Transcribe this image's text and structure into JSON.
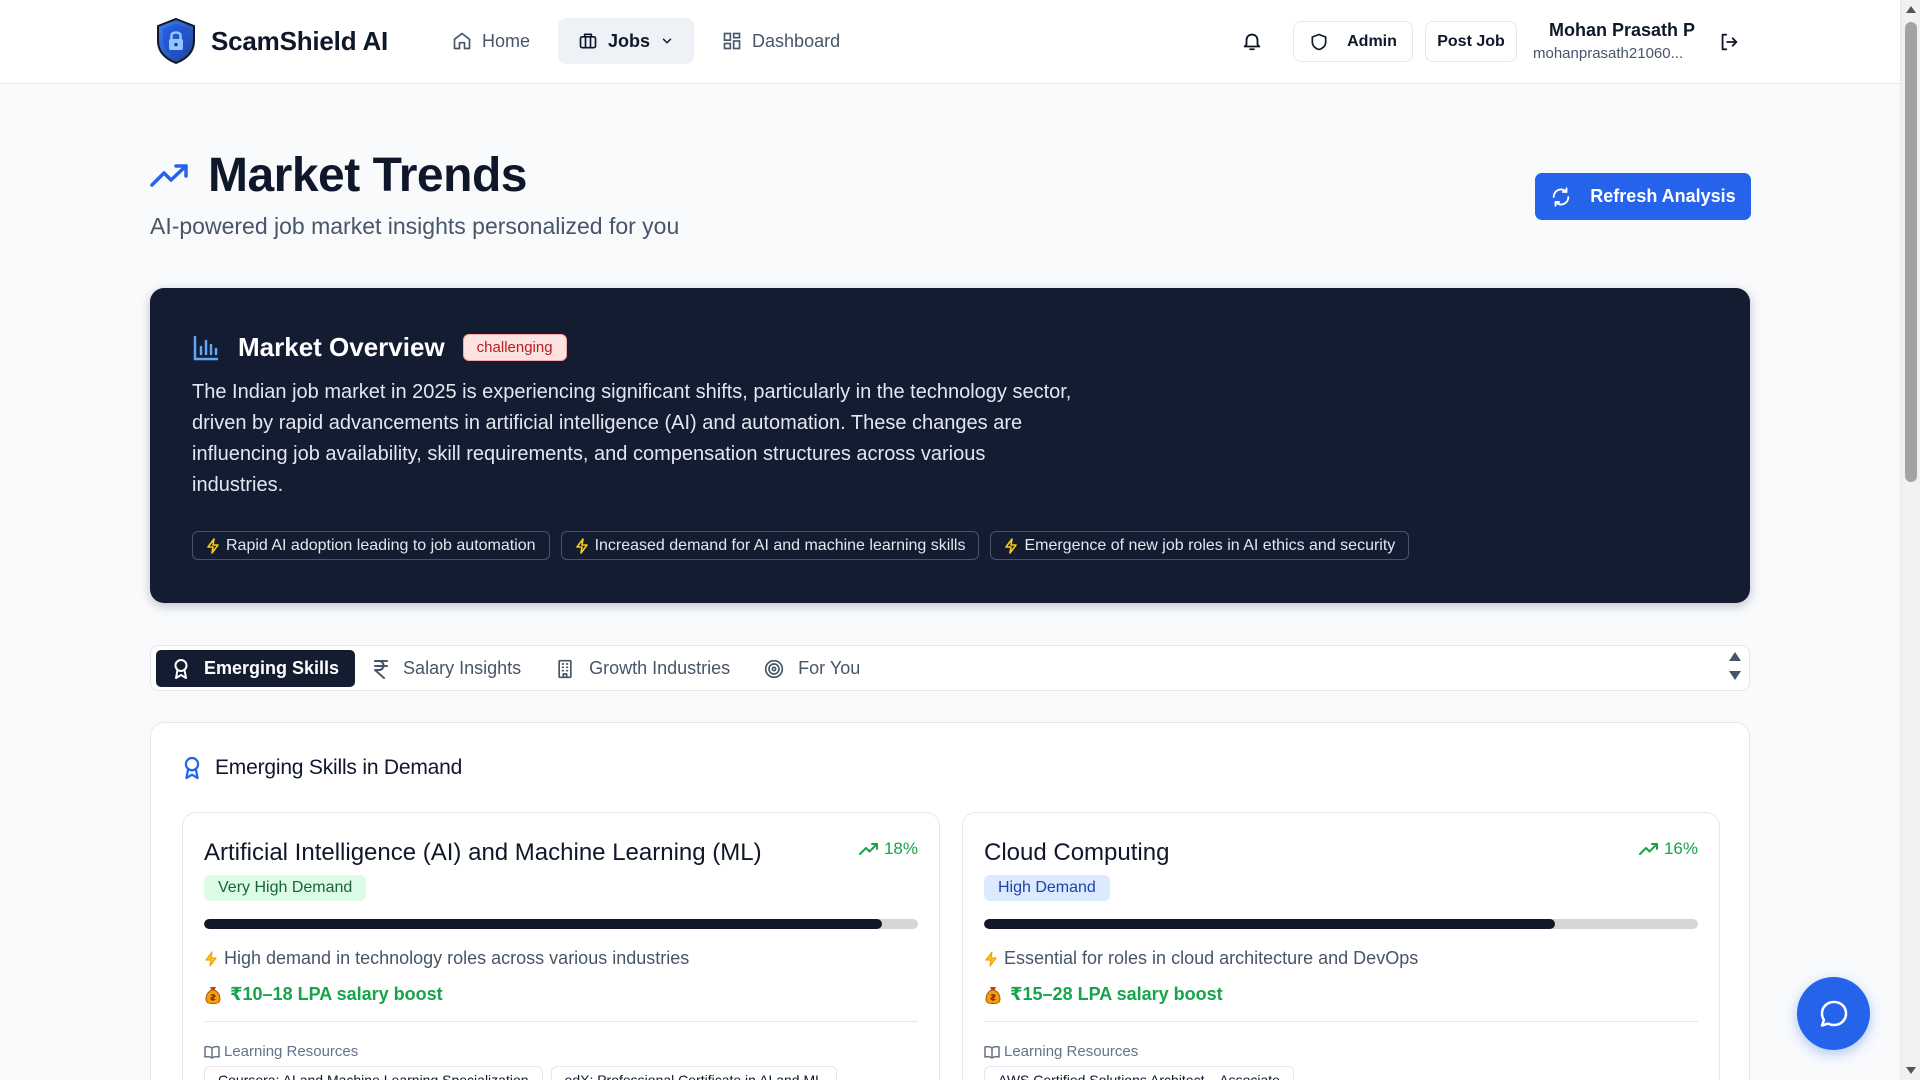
{
  "brand": {
    "name": "ScamShield AI"
  },
  "nav": {
    "home": "Home",
    "jobs": "Jobs",
    "dashboard": "Dashboard"
  },
  "header": {
    "admin_label": "Admin",
    "post_job_label": "Post Job",
    "user_name": "Mohan Prasath P",
    "user_email": "mohanprasath21060..."
  },
  "page": {
    "title": "Market Trends",
    "subtitle": "AI-powered job market insights personalized for you",
    "refresh_label": "Refresh Analysis"
  },
  "overview": {
    "title": "Market Overview",
    "badge": "challenging",
    "text": "The Indian job market in 2025 is experiencing significant shifts, particularly in the technology sector, driven by rapid advancements in artificial intelligence (AI) and automation. These changes are influencing job availability, skill requirements, and compensation structures across various industries.",
    "tags": [
      "Rapid AI adoption leading to job automation",
      "Increased demand for AI and machine learning skills",
      "Emergence of new job roles in AI ethics and security"
    ]
  },
  "tabs": [
    {
      "label": "Emerging Skills"
    },
    {
      "label": "Salary Insights"
    },
    {
      "label": "Growth Industries"
    },
    {
      "label": "For You"
    }
  ],
  "skills": {
    "title": "Emerging Skills in Demand",
    "resources_label": "Learning Resources",
    "cards": [
      {
        "title": "Artificial Intelligence (AI) and Machine Learning (ML)",
        "growth": "18%",
        "demand": "Very High Demand",
        "demand_level": 0.95,
        "description": "High demand in technology roles across various industries",
        "salary": "₹10–18 LPA salary boost",
        "resources": [
          "Coursera: AI and Machine Learning Specialization",
          "edX: Professional Certificate in AI and ML"
        ]
      },
      {
        "title": "Cloud Computing",
        "growth": "16%",
        "demand": "High Demand",
        "demand_level": 0.8,
        "description": "Essential for roles in cloud architecture and DevOps",
        "salary": "₹15–28 LPA salary boost",
        "resources": [
          "AWS Certified Solutions Architect – Associate"
        ]
      }
    ]
  },
  "colors": {
    "primary": "#2563eb",
    "dark_panel": "#131c30",
    "success": "#16a34a",
    "danger_badge": "#b91c1c"
  }
}
